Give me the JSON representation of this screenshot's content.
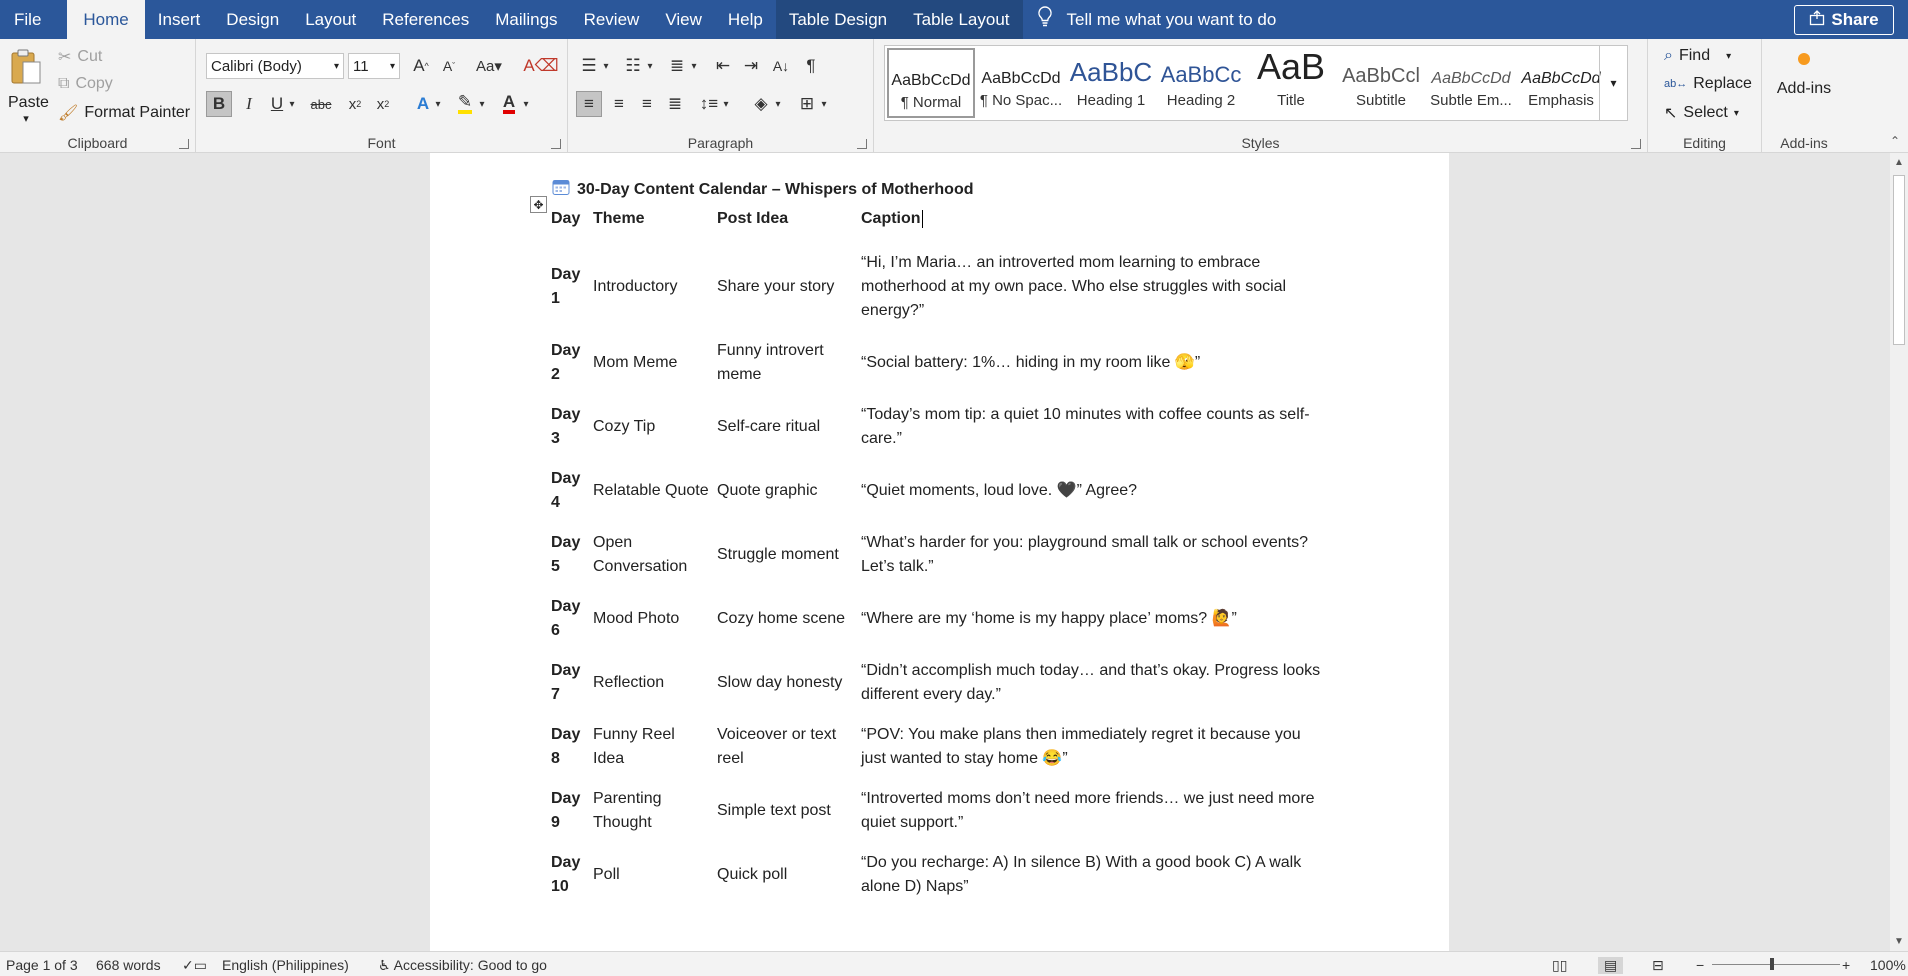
{
  "tabs": [
    "File",
    "Home",
    "Insert",
    "Design",
    "Layout",
    "References",
    "Mailings",
    "Review",
    "View",
    "Help",
    "Table Design",
    "Table Layout"
  ],
  "tell_me": "Tell me what you want to do",
  "share": "Share",
  "clipboard": {
    "paste": "Paste",
    "cut": "Cut",
    "copy": "Copy",
    "format_painter": "Format Painter",
    "label": "Clipboard"
  },
  "font": {
    "name": "Calibri (Body)",
    "size": "11",
    "label": "Font"
  },
  "paragraph": {
    "label": "Paragraph"
  },
  "styles": {
    "label": "Styles",
    "items": [
      {
        "preview": "AaBbCcDd",
        "name": "¶ Normal"
      },
      {
        "preview": "AaBbCcDd",
        "name": "¶ No Spac..."
      },
      {
        "preview": "AaBbC",
        "name": "Heading 1"
      },
      {
        "preview": "AaBbCc",
        "name": "Heading 2"
      },
      {
        "preview": "AaB",
        "name": "Title"
      },
      {
        "preview": "AaBbCcl",
        "name": "Subtitle"
      },
      {
        "preview": "AaBbCcDd",
        "name": "Subtle Em..."
      },
      {
        "preview": "AaBbCcDd",
        "name": "Emphasis"
      }
    ]
  },
  "editing": {
    "find": "Find",
    "replace": "Replace",
    "select": "Select",
    "label": "Editing"
  },
  "addins": {
    "button": "Add-ins",
    "label": "Add-ins"
  },
  "document": {
    "title": "30-Day Content Calendar – Whispers of Motherhood",
    "headers": [
      "Day",
      "Theme",
      "Post Idea",
      "Caption"
    ],
    "rows": [
      {
        "day": "Day 1",
        "theme": "Introductory",
        "idea": "Share your story",
        "caption": "“Hi, I’m Maria… an introverted mom learning to embrace motherhood at my own pace. Who else struggles with social energy?”"
      },
      {
        "day": "Day 2",
        "theme": "Mom Meme",
        "idea": "Funny introvert meme",
        "caption": "“Social battery: 1%… hiding in my room like 🫣”"
      },
      {
        "day": "Day 3",
        "theme": "Cozy Tip",
        "idea": "Self-care ritual",
        "caption": "“Today’s mom tip: a quiet 10 minutes with coffee counts as self-care.”"
      },
      {
        "day": "Day 4",
        "theme": "Relatable Quote",
        "idea": "Quote graphic",
        "caption": "“Quiet moments, loud love. 🖤” Agree?"
      },
      {
        "day": "Day 5",
        "theme": "Open Conversation",
        "idea": "Struggle moment",
        "caption": "“What’s harder for you: playground small talk or school events? Let’s talk.”"
      },
      {
        "day": "Day 6",
        "theme": "Mood Photo",
        "idea": "Cozy home scene",
        "caption": "“Where are my ‘home is my happy place’ moms? 🙋”"
      },
      {
        "day": "Day 7",
        "theme": "Reflection",
        "idea": "Slow day honesty",
        "caption": "“Didn’t accomplish much today… and that’s okay. Progress looks different every day.”"
      },
      {
        "day": "Day 8",
        "theme": "Funny Reel Idea",
        "idea": "Voiceover or text reel",
        "caption": "“POV: You make plans then immediately regret it because you just wanted to stay home 😂”"
      },
      {
        "day": "Day 9",
        "theme": "Parenting Thought",
        "idea": "Simple text post",
        "caption": "“Introverted moms don’t need more friends… we just need more quiet support.”"
      },
      {
        "day": "Day 10",
        "theme": "Poll",
        "idea": "Quick poll",
        "caption": "“Do you recharge: A) In silence B) With a good book C) A walk alone D) Naps”"
      }
    ]
  },
  "status": {
    "page": "Page 1 of 3",
    "words": "668 words",
    "language": "English (Philippines)",
    "accessibility": "Accessibility: Good to go",
    "zoom": "100%"
  }
}
